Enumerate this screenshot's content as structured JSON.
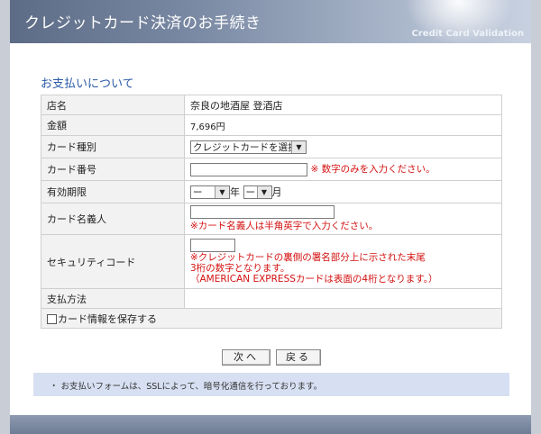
{
  "header": {
    "title": "クレジットカード決済のお手続き",
    "subtitle": "Credit Card Validation"
  },
  "section_title": "お支払いについて",
  "form": {
    "shop_label": "店名",
    "shop_value": "奈良の地酒屋 登酒店",
    "amount_label": "金額",
    "amount_value": "7,696円",
    "card_type_label": "カード種別",
    "card_type_selected": "クレジットカードを選択",
    "card_number_label": "カード番号",
    "card_number_value": "",
    "card_number_note": "※ 数字のみを入力ください。",
    "expiry_label": "有効期限",
    "expiry_month_value": "ー",
    "expiry_year_unit": "年",
    "expiry_day_value": "ー",
    "expiry_month_unit": "月",
    "holder_label": "カード名義人",
    "holder_value": "",
    "holder_note": "※カード名義人は半角英字で入力ください。",
    "security_label": "セキュリティコード",
    "security_value": "",
    "security_note_1": "※クレジットカードの裏側の署名部分上に示された末尾",
    "security_note_2": "3桁の数字となります。",
    "security_note_3": "（AMERICAN EXPRESSカードは表面の4桁となります。）",
    "payment_method_label": "支払方法",
    "save_card_label": "カード情報を保存する"
  },
  "buttons": {
    "next": "次へ",
    "back": "戻る"
  },
  "note": "・ お支払いフォームは、SSLによって、暗号化通信を行っております。"
}
